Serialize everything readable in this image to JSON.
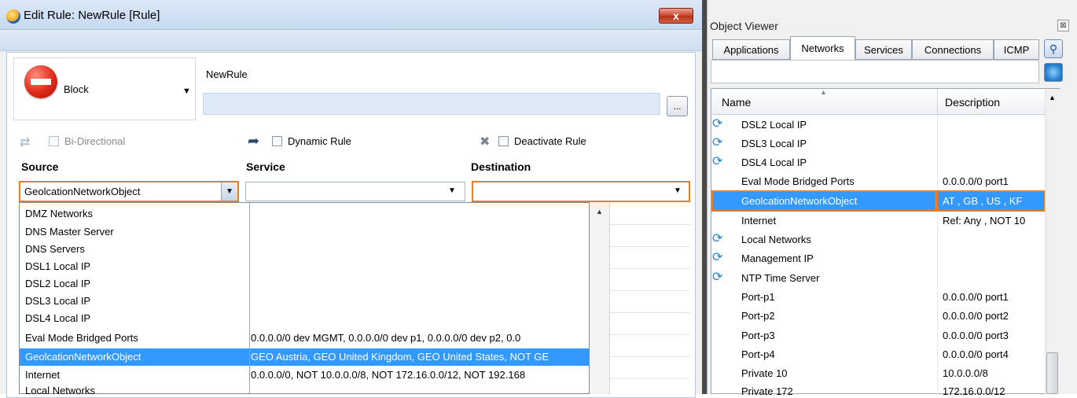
{
  "edit_window": {
    "title": "Edit Rule: NewRule [Rule]",
    "close_glyph": "x",
    "action": {
      "label": "Block",
      "icon": "block-icon"
    },
    "rule_name": "NewRule",
    "more_button": "...",
    "options": {
      "bi_directional": "Bi-Directional",
      "dynamic_rule": "Dynamic Rule",
      "deactivate_rule": "Deactivate Rule"
    },
    "columns": {
      "source": "Source",
      "service": "Service",
      "destination": "Destination"
    },
    "source_value": "GeolcationNetworkObject",
    "dropdown_items": [
      {
        "name": "DMZ Networks",
        "desc": ""
      },
      {
        "name": "DNS Master Server",
        "desc": ""
      },
      {
        "name": "DNS Servers",
        "desc": ""
      },
      {
        "name": "DSL1 Local IP",
        "desc": ""
      },
      {
        "name": "DSL2 Local IP",
        "desc": ""
      },
      {
        "name": "DSL3 Local IP",
        "desc": ""
      },
      {
        "name": "DSL4 Local IP",
        "desc": ""
      },
      {
        "name": "Eval Mode Bridged Ports",
        "desc": "0.0.0.0/0 dev MGMT, 0.0.0.0/0 dev p1, 0.0.0.0/0 dev p2, 0.0"
      },
      {
        "name": "GeolcationNetworkObject",
        "desc": "GEO Austria, GEO United Kingdom, GEO United States, NOT GE"
      },
      {
        "name": "Internet",
        "desc": "0.0.0.0/0, NOT 10.0.0.0/8, NOT 172.16.0.0/12, NOT 192.168"
      },
      {
        "name": "Local Networks",
        "desc": ""
      }
    ],
    "selected_index": 8
  },
  "viewer": {
    "title": "Object Viewer",
    "close_glyph": "⊠",
    "tabs": [
      "Applications",
      "Networks",
      "Services",
      "Connections",
      "ICMP"
    ],
    "active_tab": "Networks",
    "headers": {
      "name": "Name",
      "description": "Description"
    },
    "rows": [
      {
        "name": "DSL2 Local IP",
        "desc": "",
        "icon": "dynamic-network-icon"
      },
      {
        "name": "DSL3 Local IP",
        "desc": "",
        "icon": "dynamic-network-icon"
      },
      {
        "name": "DSL4 Local IP",
        "desc": "",
        "icon": "dynamic-network-icon"
      },
      {
        "name": "Eval Mode Bridged Ports",
        "desc": "0.0.0.0/0 port1",
        "icon": ""
      },
      {
        "name": "GeolcationNetworkObject",
        "desc": "AT , GB , US , KF",
        "icon": ""
      },
      {
        "name": "Internet",
        "desc": "Ref: Any , NOT 10",
        "icon": ""
      },
      {
        "name": "Local Networks",
        "desc": "",
        "icon": "dynamic-network-icon"
      },
      {
        "name": "Management IP",
        "desc": "",
        "icon": "dynamic-network-icon"
      },
      {
        "name": "NTP Time Server",
        "desc": "",
        "icon": "dynamic-network-icon"
      },
      {
        "name": "Port-p1",
        "desc": "0.0.0.0/0 port1",
        "icon": ""
      },
      {
        "name": "Port-p2",
        "desc": "0.0.0.0/0 port2",
        "icon": ""
      },
      {
        "name": "Port-p3",
        "desc": "0.0.0.0/0 port3",
        "icon": ""
      },
      {
        "name": "Port-p4",
        "desc": "0.0.0.0/0 port4",
        "icon": ""
      },
      {
        "name": "Private 10",
        "desc": "10.0.0.0/8",
        "icon": ""
      },
      {
        "name": "Private 172",
        "desc": "172.16.0.0/12",
        "icon": ""
      }
    ],
    "selected_index": 4
  },
  "colors": {
    "highlight": "#3399ff",
    "focus_outline": "#f07b1c",
    "block_red": "#e02a18"
  }
}
